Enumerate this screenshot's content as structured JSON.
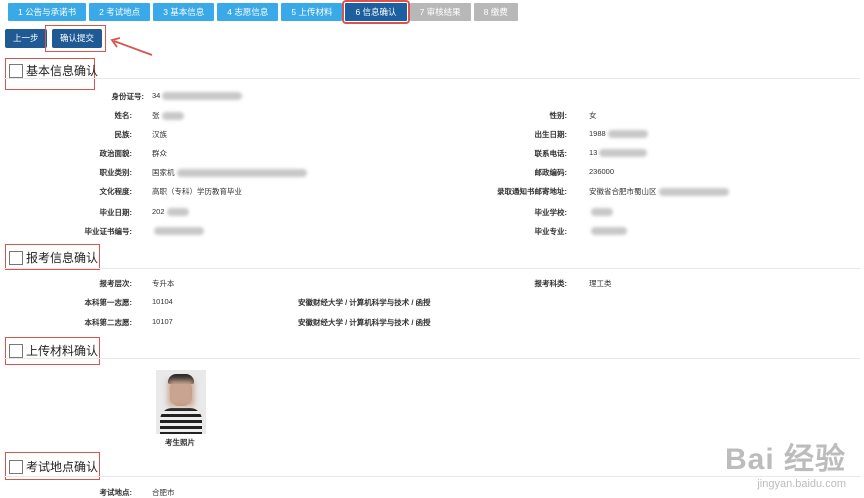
{
  "steps": [
    {
      "label": "1 公告与承诺书",
      "state": "normal"
    },
    {
      "label": "2 考试地点",
      "state": "normal"
    },
    {
      "label": "3 基本信息",
      "state": "normal"
    },
    {
      "label": "4 志愿信息",
      "state": "normal"
    },
    {
      "label": "5 上传材料",
      "state": "normal"
    },
    {
      "label": "6 信息确认",
      "state": "active"
    },
    {
      "label": "7 审核结果",
      "state": "disabled"
    },
    {
      "label": "8 缴费",
      "state": "disabled"
    }
  ],
  "buttons": {
    "prev": "上一步",
    "submit": "确认提交"
  },
  "sections": {
    "basic": "基本信息确认",
    "exam": "报考信息确认",
    "upload": "上传材料确认",
    "location": "考试地点确认"
  },
  "basic": {
    "id_label": "身份证号:",
    "id_value": "34",
    "name_label": "姓名:",
    "name_value": "张",
    "gender_label": "性别:",
    "gender_value": "女",
    "ethnicity_label": "民族:",
    "ethnicity_value": "汉族",
    "birth_label": "出生日期:",
    "birth_value": "1988",
    "political_label": "政治面貌:",
    "political_value": "群众",
    "phone_label": "联系电话:",
    "phone_value": "13",
    "occupation_label": "职业类别:",
    "occupation_value": "国家机",
    "postal_label": "邮政编码:",
    "postal_value": "236000",
    "education_label": "文化程度:",
    "education_value": "高职（专科）学历教育毕业",
    "address_label": "录取通知书邮寄地址:",
    "address_value": "安徽省合肥市蜀山区",
    "grad_date_label": "毕业日期:",
    "grad_date_value": "202",
    "school_label": "毕业学校:",
    "school_value": "",
    "cert_label": "毕业证书编号:",
    "cert_value": "",
    "major_label": "毕业专业:",
    "major_value": ""
  },
  "exam": {
    "level_label": "报考层次:",
    "level_value": "专升本",
    "category_label": "报考科类:",
    "category_value": "理工类",
    "first_label": "本科第一志愿:",
    "first_code": "10104",
    "first_desc": "安徽财经大学 / 计算机科学与技术 / 函授",
    "second_label": "本科第二志愿:",
    "second_code": "10107",
    "second_desc": "安徽财经大学 / 计算机科学与技术 / 函授"
  },
  "upload": {
    "photo_caption": "考生照片"
  },
  "location": {
    "label": "考试地点:",
    "value": "合肥市"
  },
  "watermark": {
    "brand": "Bai 经验",
    "url": "jingyan.baidu.com"
  },
  "colors": {
    "step_blue": "#3aa9e8",
    "step_active": "#1d5f9f",
    "step_disabled": "#b8b8b8",
    "button": "#1f5a94",
    "highlight_red": "#d9534f"
  }
}
